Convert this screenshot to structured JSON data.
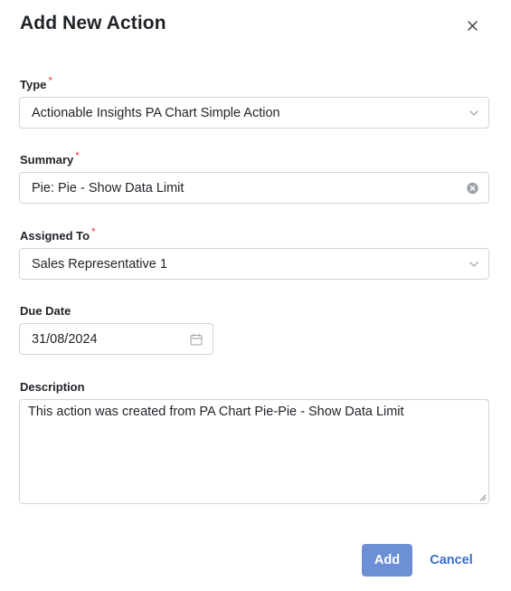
{
  "dialog": {
    "title": "Add New Action",
    "close_icon": "close-icon"
  },
  "form": {
    "type": {
      "label": "Type",
      "required_mark": "*",
      "value": "Actionable Insights PA Chart Simple Action",
      "icon": "chevron-down-icon"
    },
    "summary": {
      "label": "Summary",
      "required_mark": "*",
      "value": "Pie: Pie - Show Data Limit",
      "icon": "clear-icon"
    },
    "assigned_to": {
      "label": "Assigned To",
      "required_mark": "*",
      "value": "Sales Representative 1",
      "icon": "chevron-down-icon"
    },
    "due_date": {
      "label": "Due Date",
      "value": "31/08/2024",
      "icon": "calendar-icon"
    },
    "description": {
      "label": "Description",
      "value": "This action was created from PA Chart Pie-Pie - Show Data Limit"
    }
  },
  "actions": {
    "add_label": "Add",
    "cancel_label": "Cancel"
  },
  "colors": {
    "primary_button": "#6d8fd6",
    "link": "#3a6fc9",
    "required": "#e5484d",
    "border": "#d0d4d9"
  }
}
